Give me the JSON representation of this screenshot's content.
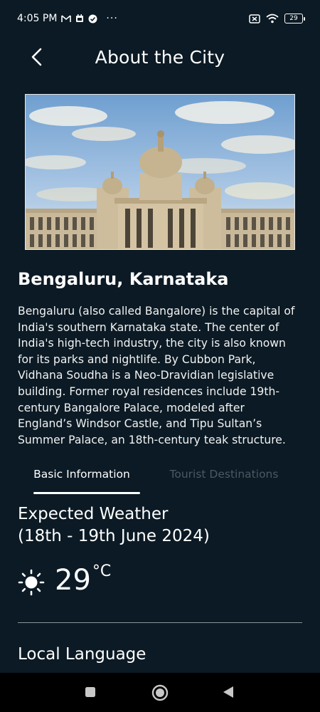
{
  "status_bar": {
    "time": "4:05 PM",
    "battery": "29",
    "more": "···"
  },
  "header": {
    "title": "About the City",
    "back_icon": "chevron-left-icon"
  },
  "city": {
    "name": "Bengaluru, Karnataka",
    "description": "Bengaluru (also called Bangalore) is the capital of India's southern Karnataka state. The center of India's high-tech industry, the city is also known for its parks and nightlife. By Cubbon Park, Vidhana Soudha is a Neo-Dravidian legislative building. Former royal residences include 19th-century Bangalore Palace, modeled after England’s Windsor Castle, and Tipu Sultan’s Summer Palace, an 18th-century teak structure."
  },
  "tabs": [
    {
      "label": "Basic Information",
      "active": true
    },
    {
      "label": "Tourist Destinations",
      "active": false
    }
  ],
  "weather": {
    "title_line1": "Expected Weather",
    "title_line2": "(18th - 19th June 2024)",
    "temperature": "29",
    "unit": "°C",
    "icon": "sun-icon"
  },
  "sections": {
    "local_language": "Local Language"
  },
  "colors": {
    "background": "#0b1a24",
    "text": "#ffffff",
    "inactive_tab": "#4a5a62",
    "nav_bar": "#000000"
  }
}
